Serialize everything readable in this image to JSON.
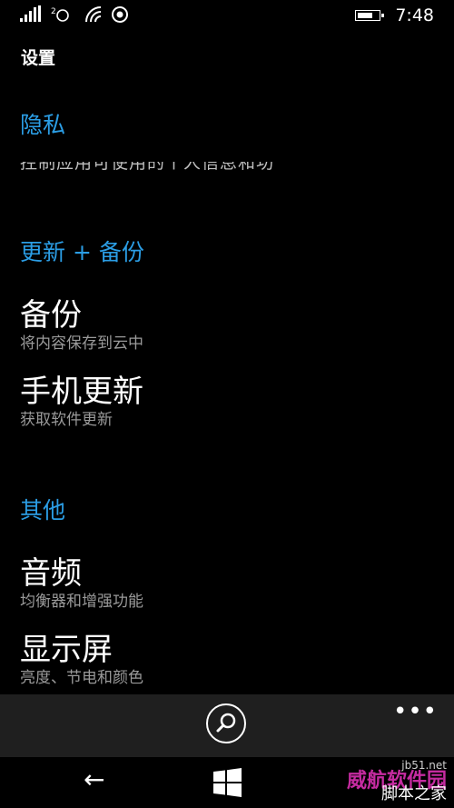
{
  "status": {
    "time": "7:48"
  },
  "page_title": "设置",
  "sections": {
    "privacy": {
      "header": "隐私",
      "cut_text": "控制应用可使用的个人信息和功能"
    },
    "update_backup": {
      "header": "更新 + 备份",
      "items": [
        {
          "title": "备份",
          "subtitle": "将内容保存到云中"
        },
        {
          "title": "手机更新",
          "subtitle": "获取软件更新"
        }
      ]
    },
    "other": {
      "header": "其他",
      "items": [
        {
          "title": "音频",
          "subtitle": "均衡器和增强功能"
        },
        {
          "title": "显示屏",
          "subtitle": "亮度、节电和颜色"
        }
      ]
    }
  },
  "app_bar": {
    "more_label": "•••"
  },
  "nav": {
    "back_label": "←"
  },
  "watermark": {
    "text": "威航软件园",
    "small": "jb51.net",
    "logo_text": "脚本之家"
  }
}
